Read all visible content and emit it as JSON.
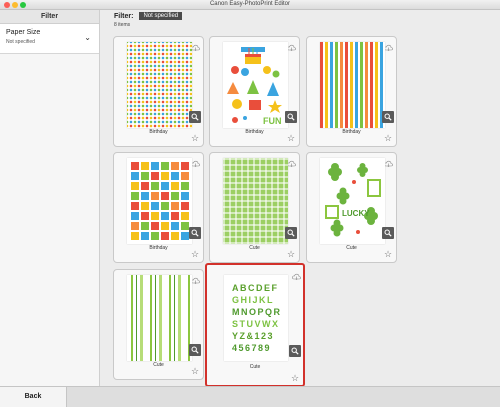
{
  "window": {
    "title": "Canon Easy-PhotoPrint Editor"
  },
  "sidebar": {
    "title": "Filter",
    "items": [
      {
        "label": "Paper Size",
        "value": "Not specified"
      }
    ]
  },
  "main": {
    "filter_label": "Filter:",
    "filter_value": "Not specified",
    "count": "8 items",
    "cards": [
      {
        "label": "Birthday",
        "icon": "zoom-icon",
        "selected": false
      },
      {
        "label": "Birthday",
        "icon": "zoom-icon",
        "selected": false
      },
      {
        "label": "Birthday",
        "icon": "zoom-icon",
        "selected": false
      },
      {
        "label": "Birthday",
        "icon": "zoom-icon",
        "selected": false
      },
      {
        "label": "Cute",
        "icon": "zoom-icon",
        "selected": false
      },
      {
        "label": "Cute",
        "icon": "zoom-icon",
        "selected": false
      },
      {
        "label": "Cute",
        "icon": "zoom-icon",
        "selected": false
      },
      {
        "label": "Cute",
        "icon": "zoom-icon",
        "selected": true
      }
    ],
    "alphabet_rows": [
      "ABCDEF",
      "GHIJKL",
      "MNOPQR",
      "STUVWX",
      "YZ&123",
      "456789"
    ],
    "fun_text": "FUN",
    "lucky_text": "LUCKY"
  },
  "footer": {
    "back_label": "Back"
  },
  "colors": {
    "selection": "#d2312b",
    "filter_badge": "#4b4b4b"
  }
}
